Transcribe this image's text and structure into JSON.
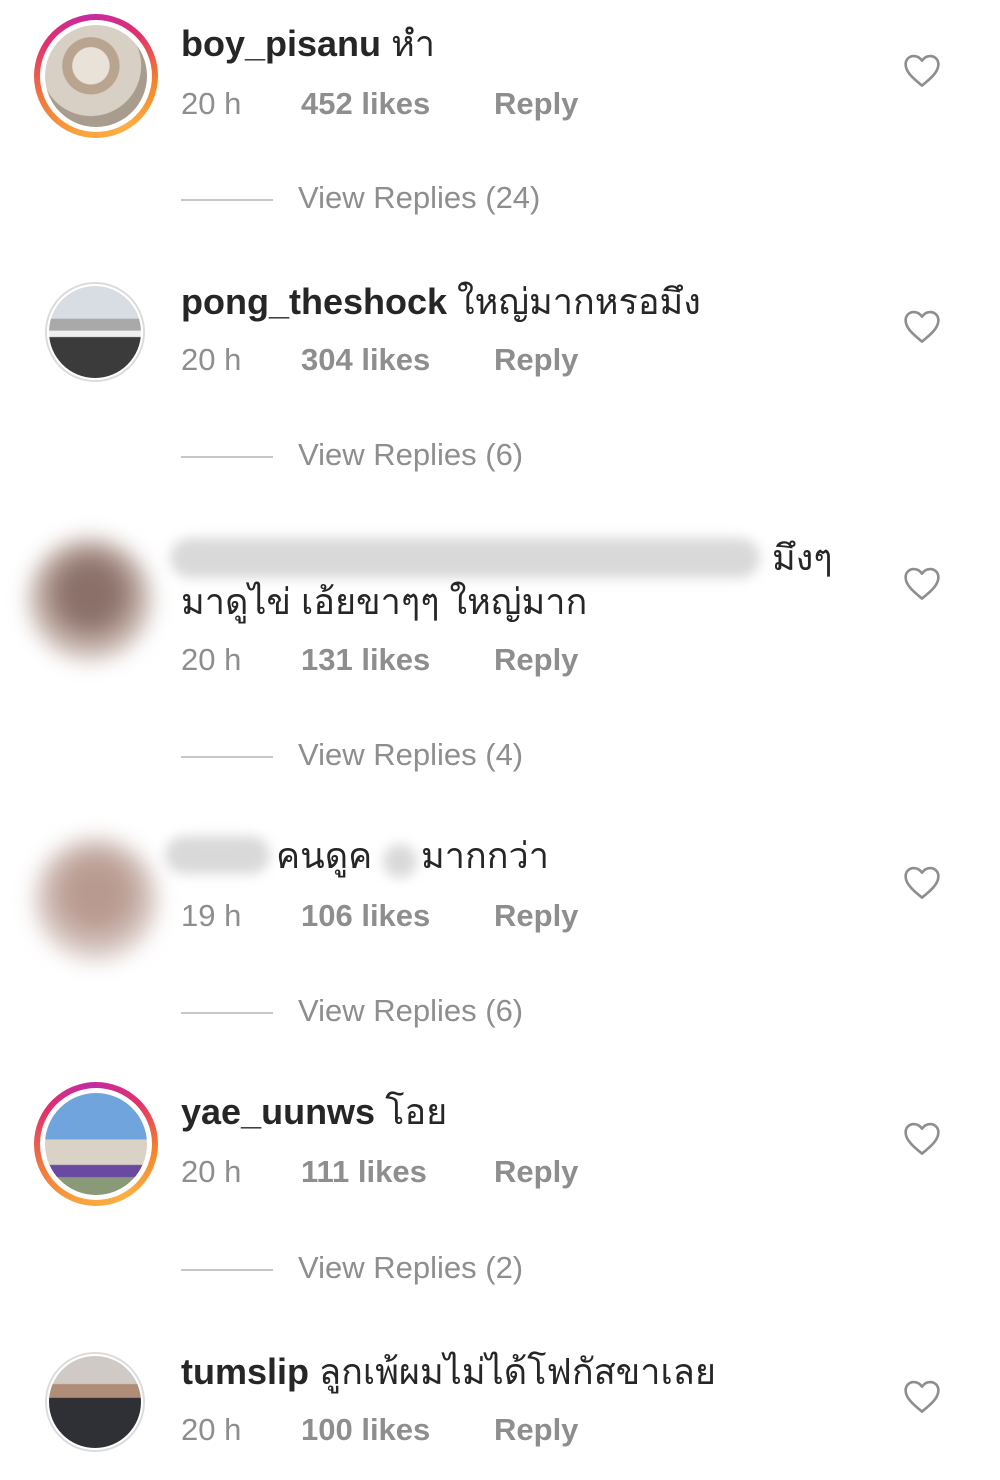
{
  "comments": [
    {
      "username": "boy_pisanu",
      "text": "หำ",
      "time": "20 h",
      "likes": "452 likes",
      "reply": "Reply",
      "view_replies": "View Replies (24)",
      "heart_icon": "heart-outline-icon"
    },
    {
      "username": "pong_theshock",
      "text": "ใหญ่มากหรอมึง",
      "time": "20 h",
      "likes": "304 likes",
      "reply": "Reply",
      "view_replies": "View Replies (6)",
      "heart_icon": "heart-outline-icon"
    },
    {
      "username": "",
      "text_end": "มึงๆ",
      "text_line2": "มาดูไข่ เอ้ยขาๆๆ ใหญ่มาก",
      "time": "20 h",
      "likes": "131 likes",
      "reply": "Reply",
      "view_replies": "View Replies (4)",
      "heart_icon": "heart-outline-icon"
    },
    {
      "username": "",
      "text_a": "คนดูค",
      "text_b": "มากกว่า",
      "time": "19 h",
      "likes": "106 likes",
      "reply": "Reply",
      "view_replies": "View Replies (6)",
      "heart_icon": "heart-outline-icon"
    },
    {
      "username": "yae_uunws",
      "text": "โอย",
      "time": "20 h",
      "likes": "111 likes",
      "reply": "Reply",
      "view_replies": "View Replies (2)",
      "heart_icon": "heart-outline-icon"
    },
    {
      "username": "tumslip",
      "text": "ลูกเพ้ผมไม่ได้โฟกัสขาเลย",
      "time": "20 h",
      "likes": "100 likes",
      "reply": "Reply",
      "heart_icon": "heart-outline-icon"
    }
  ],
  "colors": {
    "text": "#262626",
    "secondary": "#8e8e8e",
    "divider": "#c7c7c7",
    "story_ring_start": "#f9a13a",
    "story_ring_end": "#c32aa3"
  }
}
